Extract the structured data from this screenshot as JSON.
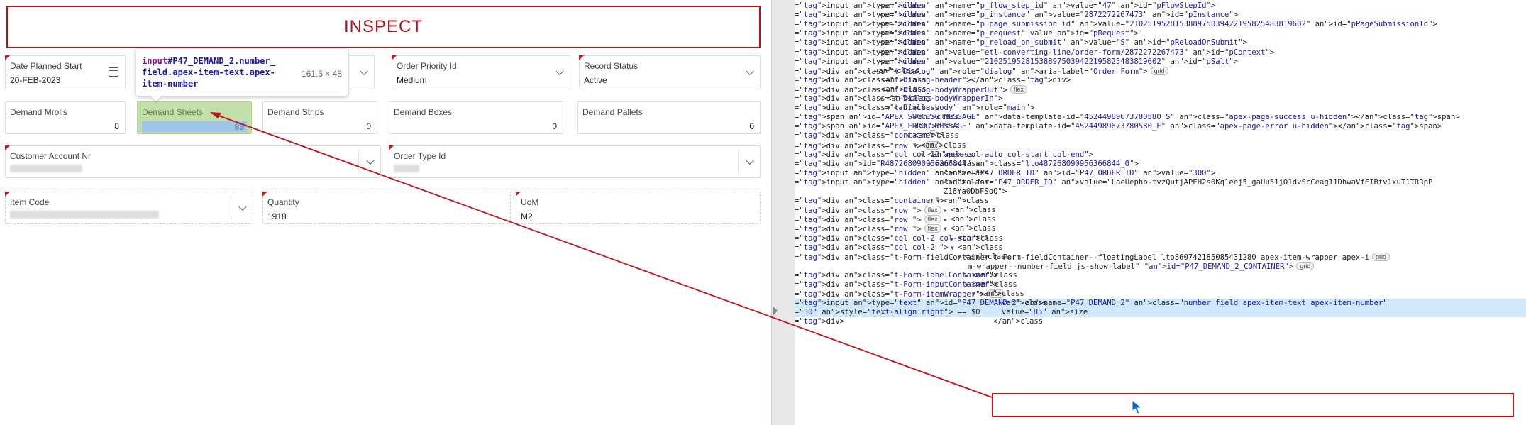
{
  "left": {
    "inspect_banner": "INSPECT",
    "tooltip": {
      "selector_tag": "input",
      "selector_rest": "#P47_DEMAND_2.number_field.apex-item-text.apex-item-number",
      "dimensions": "161.5 × 48"
    },
    "row1": {
      "date_planned_start": {
        "label": "Date Planned Start",
        "value": "20-FEB-2023"
      },
      "order_priority": {
        "label": "Order Priority Id",
        "value": "Medium"
      },
      "record_status": {
        "label": "Record Status",
        "value": "Active"
      }
    },
    "row2": {
      "demand_mrolls": {
        "label": "Demand Mrolls",
        "value": "8"
      },
      "demand_sheets": {
        "label": "Demand Sheets",
        "value": "85"
      },
      "demand_strips": {
        "label": "Demand Strips",
        "value": "0"
      },
      "demand_boxes": {
        "label": "Demand Boxes",
        "value": "0"
      },
      "demand_pallets": {
        "label": "Demand Pallets",
        "value": "0"
      }
    },
    "row3": {
      "customer_account": {
        "label": "Customer Account Nr"
      },
      "order_type": {
        "label": "Order Type Id"
      }
    },
    "row4": {
      "item_code": {
        "label": "Item Code"
      },
      "quantity": {
        "label": "Quantity",
        "value": "1918"
      },
      "uom": {
        "label": "UoM",
        "value": "M2"
      }
    }
  },
  "devtools": {
    "lines": [
      "<input type=\"hidden\" name=\"p_flow_step_id\" value=\"47\" id=\"pFlowStepId\">",
      "<input type=\"hidden\" name=\"p_instance\" value=\"2872272267473\" id=\"pInstance\">",
      "<input type=\"hidden\" name=\"p_page_submission_id\" value=\"210251952815388975039422195825483819602\" id=\"pPageSubmissionId\">",
      "<input type=\"hidden\" name=\"p_request\" value id=\"pRequest\">",
      "<input type=\"hidden\" name=\"p_reload_on_submit\" value=\"S\" id=\"pReloadOnSubmit\">",
      "<input type=\"hidden\" value=\"etl-converting-line/order-form/2872272267473\" id=\"pContext\">",
      "<input type=\"hidden\" value=\"210251952815388975039422195825483819602\" id=\"pSalt\">",
      "<div class=\"t-Dialog\" role=\"dialog\" aria-label=\"Order Form\">",
      "<div class=\"t-Dialog-header\"></div>",
      "<div class=\"t-Dialog-bodyWrapperOut\">",
      "<div class=\"t-Dialog-bodyWrapperIn\">",
      "<div class=\"t-Dialog-body\" role=\"main\">",
      "<span id=\"APEX_SUCCESS_MESSAGE\" data-template-id=\"45244989673780580_S\" class=\"apex-page-success u-hidden\"></span>",
      "<span id=\"APEX_ERROR_MESSAGE\" data-template-id=\"45244989673780580_E\" class=\"apex-page-error u-hidden\"></span>",
      "<div class=\"container\">",
      "<div class=\"row \">",
      "<div class=\"col col-12 apex-col-auto col-start col-end\">",
      "<div id=\"R487268090956366844\" class=\"lto487268090956366844_0\">",
      "<input type=\"hidden\" name=\"P47_ORDER_ID\" id=\"P47_ORDER_ID\" value=\"300\">",
      "<input type=\"hidden\" data-for=\"P47_ORDER_ID\" value=\"LaeUephb-tvzQutjAPEH2s0Kq1eej5_gaUu51jO1dvScCeag11DhwaVfEIBtv1xuT1TRRpP",
      "Z18Ya0DbFSoQ\">",
      "<div class=\"container\">",
      "<div class=\"row \">",
      "<div class=\"row \">",
      "<div class=\"row \">",
      "<div class=\"col col-2  col-start\">",
      "<div class=\"col col-2  \">",
      "<div class=\"t-Form-fieldContainer t-Form-fieldContainer--floatingLabel lto860742185085431280 apex-item-wrapper apex-i",
      "m-wrapper--number-field js-show-label\" id=\"P47_DEMAND_2_CONTAINER\">",
      "<div class=\"t-Form-labelContainer\">",
      "<div class=\"t-Form-inputContainer\">",
      "<div class=\"t-Form-itemWrapper\">",
      "<input type=\"text\" id=\"P47_DEMAND_2\" name=\"P47_DEMAND_2\" class=\"number_field apex-item-text apex-item-number\"",
      "value=\"85\" size=\"30\" style=\"text-align:right\"> == $0",
      "</div>"
    ],
    "badges": {
      "grid": "grid",
      "flex": "flex",
      "ellipsis": "…"
    }
  }
}
